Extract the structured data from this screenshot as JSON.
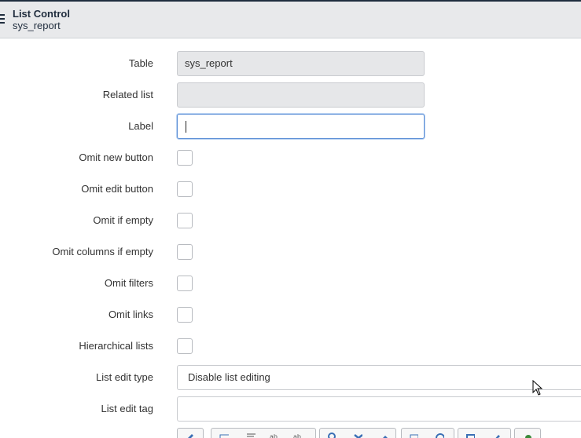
{
  "header": {
    "title": "List Control",
    "subtitle": "sys_report"
  },
  "fields": {
    "table": {
      "label": "Table",
      "value": "sys_report"
    },
    "related_list": {
      "label": "Related list",
      "value": ""
    },
    "label": {
      "label": "Label",
      "value": ""
    },
    "omit_new_button": {
      "label": "Omit new button"
    },
    "omit_edit_button": {
      "label": "Omit edit button"
    },
    "omit_if_empty": {
      "label": "Omit if empty"
    },
    "omit_columns_if_empty": {
      "label": "Omit columns if empty"
    },
    "omit_filters": {
      "label": "Omit filters"
    },
    "omit_links": {
      "label": "Omit links"
    },
    "hierarchical_lists": {
      "label": "Hierarchical lists"
    },
    "list_edit_type": {
      "label": "List edit type",
      "value": "Disable list editing"
    },
    "list_edit_tag": {
      "label": "List edit tag",
      "value": ""
    }
  },
  "colors": {
    "header_bg": "#e8e9eb",
    "focus_border": "#5c8fd6",
    "readonly_bg": "#e6e7e9"
  }
}
